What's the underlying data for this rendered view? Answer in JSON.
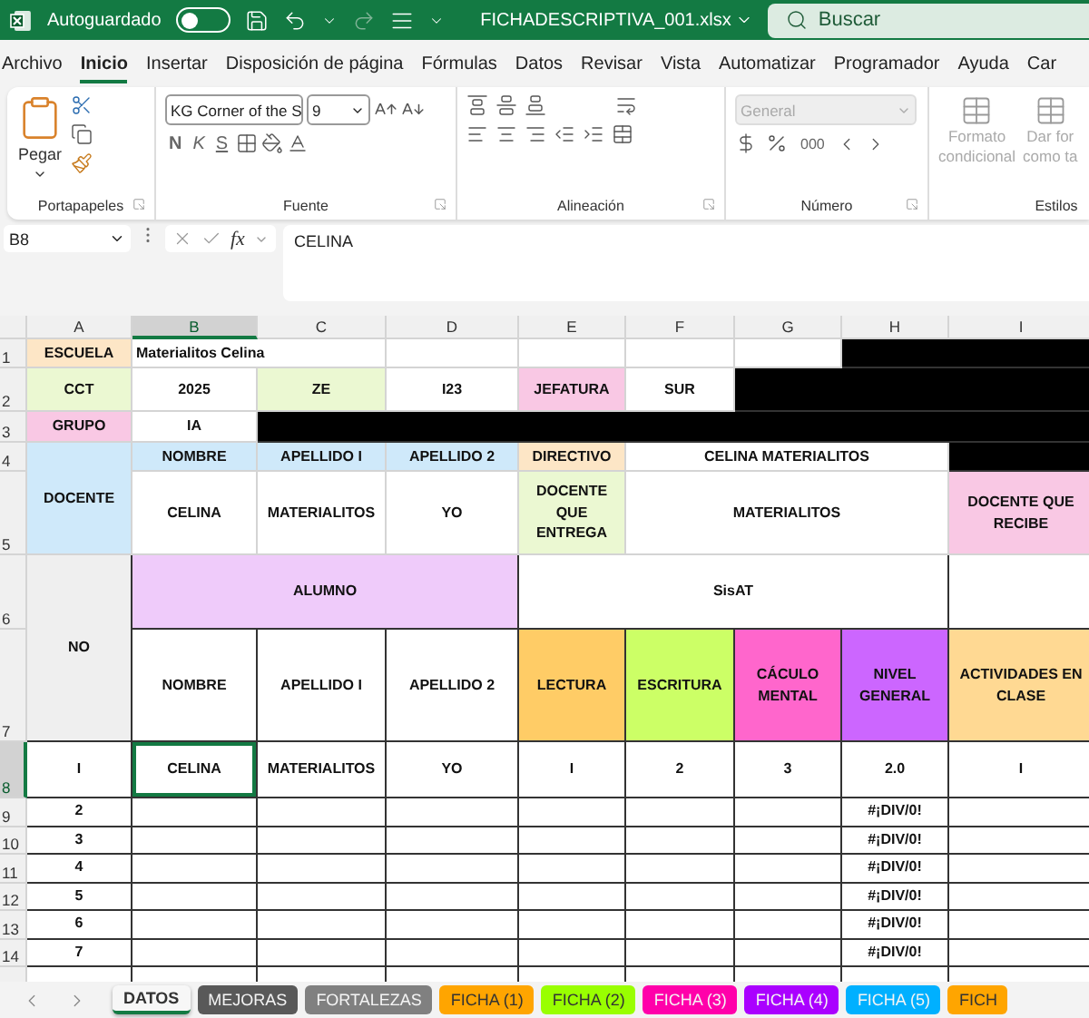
{
  "title_bar": {
    "autosave_label": "Autoguardado",
    "autosave_on": false,
    "filename": "FICHADESCRIPTIVA_001.xlsx",
    "search": {
      "placeholder": "Buscar"
    }
  },
  "menu_tabs": [
    {
      "label": "Archivo",
      "selected": false
    },
    {
      "label": "Inicio",
      "selected": true
    },
    {
      "label": "Insertar",
      "selected": false
    },
    {
      "label": "Disposición de página",
      "selected": false
    },
    {
      "label": "Fórmulas",
      "selected": false
    },
    {
      "label": "Datos",
      "selected": false
    },
    {
      "label": "Revisar",
      "selected": false
    },
    {
      "label": "Vista",
      "selected": false
    },
    {
      "label": "Automatizar",
      "selected": false
    },
    {
      "label": "Programador",
      "selected": false
    },
    {
      "label": "Ayuda",
      "selected": false
    },
    {
      "label": "Car",
      "selected": false
    }
  ],
  "ribbon": {
    "paste_label": "Pegar",
    "font_name": "KG Corner of the S",
    "font_size": "9",
    "bold": "N",
    "italic": "K",
    "underline": "S",
    "number_format": "General",
    "thousands": "000",
    "conditional_format": [
      "Formato",
      "condicional"
    ],
    "format_as_table": [
      "Dar for",
      "como ta"
    ],
    "groups": [
      "Portapapeles",
      "Fuente",
      "Alineación",
      "Número",
      "Estilos"
    ]
  },
  "formula_bar": {
    "name_box": "B8",
    "fx": "fx",
    "value": "CELINA"
  },
  "sheet": {
    "columns": [
      {
        "label": "A",
        "selected": false
      },
      {
        "label": "B",
        "selected": true
      },
      {
        "label": "C",
        "selected": false
      },
      {
        "label": "D",
        "selected": false
      },
      {
        "label": "E",
        "selected": false
      },
      {
        "label": "F",
        "selected": false
      },
      {
        "label": "G",
        "selected": false
      },
      {
        "label": "H",
        "selected": false
      },
      {
        "label": "I",
        "selected": false
      }
    ],
    "rows": [
      {
        "number": "1",
        "selected": false,
        "cells": [
          {
            "text": "ESCUELA",
            "color": "#fde6c6"
          },
          {
            "text": "Materialitos Celina",
            "colspan": 2
          },
          {},
          {},
          {},
          {},
          {
            "color": "#000000",
            "colspan": 2
          }
        ]
      },
      {
        "number": "2",
        "selected": false,
        "cells": [
          {
            "text": "CCT",
            "color": "#ebf8d2"
          },
          {
            "text": "2025"
          },
          {
            "text": "ZE",
            "color": "#ebf8d2"
          },
          {
            "text": "I23"
          },
          {
            "text": "JEFATURA",
            "color": "#f9c8e4"
          },
          {
            "text": "SUR"
          },
          {
            "color": "#000000",
            "colspan": 3
          }
        ]
      },
      {
        "number": "3",
        "selected": false,
        "cells": [
          {
            "text": "GRUPO",
            "color": "#f9c8e4"
          },
          {
            "text": "IA"
          },
          {
            "color": "#000000",
            "colspan": 7
          }
        ]
      },
      {
        "number": "4",
        "selected": false,
        "cells": [
          {
            "text": "DOCENTE",
            "color": "#cfe9fa",
            "rowspan": 2
          },
          {
            "text": "NOMBRE",
            "color": "#cfe9fa"
          },
          {
            "text": "APELLIDO I",
            "color": "#cfe9fa"
          },
          {
            "text": "APELLIDO 2",
            "color": "#cfe9fa"
          },
          {
            "text": "DIRECTIVO",
            "color": "#fde6c6"
          },
          {
            "text": "CELINA MATERIALITOS",
            "colspan": 3
          },
          {
            "color": "#000000"
          }
        ]
      },
      {
        "number": "5",
        "selected": false,
        "cells": [
          {
            "text": "CELINA"
          },
          {
            "text": "MATERIALITOS"
          },
          {
            "text": "YO"
          },
          {
            "text": "DOCENTE QUE ENTREGA",
            "color": "#ebf8d2"
          },
          {
            "text": "MATERIALITOS",
            "colspan": 3
          },
          {
            "text": "DOCENTE QUE RECIBE",
            "color": "#f9c8e4"
          }
        ]
      },
      {
        "number": "6",
        "selected": false,
        "cells": [
          {
            "text": "NO",
            "color": "#efefef",
            "rowspan": 2
          },
          {
            "text": "ALUMNO",
            "color": "#efcbfa",
            "colspan": 3
          },
          {
            "text": "SisAT",
            "colspan": 4
          }
        ]
      },
      {
        "number": "7",
        "selected": false,
        "cells": [
          {
            "text": "NOMBRE"
          },
          {
            "text": "APELLIDO I"
          },
          {
            "text": "APELLIDO 2"
          },
          {
            "text": "LECTURA",
            "color": "#ffcc66"
          },
          {
            "text": "ESCRITURA",
            "color": "#ccff66"
          },
          {
            "text": "CÁCULO MENTAL",
            "color": "#ff66cc"
          },
          {
            "text": "NIVEL GENERAL",
            "color": "#cc66ff"
          },
          {
            "text": "ACTIVIDADES EN CLASE",
            "color": "#ffd993"
          }
        ]
      },
      {
        "number": "8",
        "selected": true,
        "cells": [
          {
            "text": "I"
          },
          {
            "text": "CELINA"
          },
          {
            "text": "MATERIALITOS"
          },
          {
            "text": "YO"
          },
          {
            "text": "I"
          },
          {
            "text": "2"
          },
          {
            "text": "3"
          },
          {
            "text": "2.0"
          },
          {
            "text": "I"
          }
        ]
      },
      {
        "number": "9",
        "selected": false,
        "cells": [
          {
            "text": "2"
          },
          {},
          {},
          {},
          {},
          {},
          {},
          {
            "text": "#¡DIV/0!"
          }
        ]
      },
      {
        "number": "10",
        "selected": false,
        "cells": [
          {
            "text": "3"
          },
          {},
          {},
          {},
          {},
          {},
          {},
          {
            "text": "#¡DIV/0!"
          }
        ]
      },
      {
        "number": "11",
        "selected": false,
        "cells": [
          {
            "text": "4"
          },
          {},
          {},
          {},
          {},
          {},
          {},
          {
            "text": "#¡DIV/0!"
          }
        ]
      },
      {
        "number": "12",
        "selected": false,
        "cells": [
          {
            "text": "5"
          },
          {},
          {},
          {},
          {},
          {},
          {},
          {
            "text": "#¡DIV/0!"
          }
        ]
      },
      {
        "number": "13",
        "selected": false,
        "cells": [
          {
            "text": "6"
          },
          {},
          {},
          {},
          {},
          {},
          {},
          {
            "text": "#¡DIV/0!"
          }
        ]
      },
      {
        "number": "14",
        "selected": false,
        "cells": [
          {
            "text": "7"
          },
          {},
          {},
          {},
          {},
          {},
          {},
          {
            "text": "#¡DIV/0!"
          }
        ]
      }
    ]
  },
  "sheet_tabs": [
    {
      "label": "DATOS",
      "selected": true
    },
    {
      "label": "MEJORAS",
      "selected": false,
      "color": "#595959"
    },
    {
      "label": "FORTALEZAS",
      "selected": false,
      "color": "#808080"
    },
    {
      "label": "FICHA (1)",
      "selected": false,
      "color": "#ffa500"
    },
    {
      "label": "FICHA (2)",
      "selected": false,
      "color": "#99ff00"
    },
    {
      "label": "FICHA (3)",
      "selected": false,
      "color": "#ff00aa"
    },
    {
      "label": "FICHA (4)",
      "selected": false,
      "color": "#aa00ff"
    },
    {
      "label": "FICHA (5)",
      "selected": false,
      "color": "#00b0ff"
    },
    {
      "label": "FICH",
      "selected": false,
      "color": "#ffa500"
    }
  ]
}
